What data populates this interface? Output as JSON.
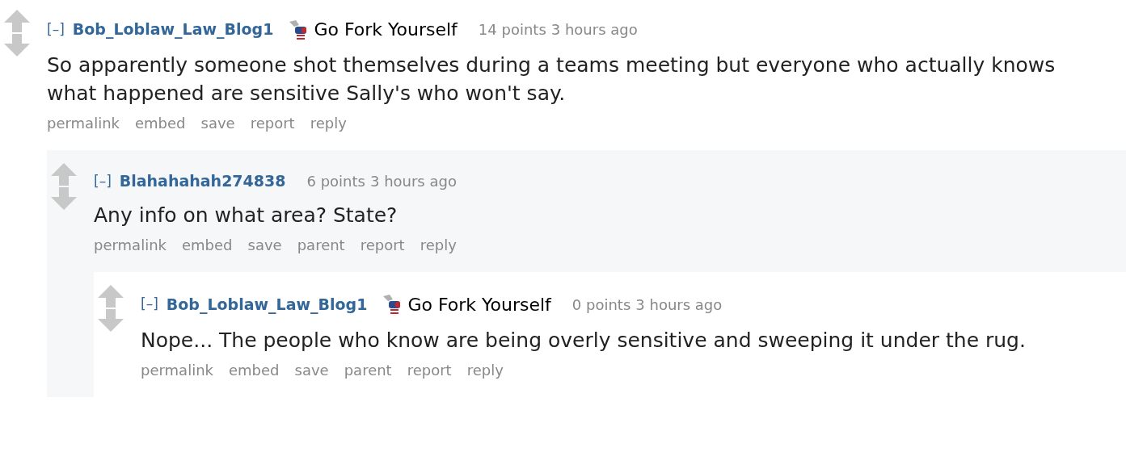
{
  "comments": [
    {
      "collapse": "[–]",
      "author": "Bob_Loblaw_Law_Blog1",
      "flair": "Go Fork Yourself",
      "score": "14 points",
      "time": "3 hours ago",
      "body": "So apparently someone shot themselves during a teams meeting but everyone who actually knows what happened are sensitive Sally's who won't say.",
      "actions": [
        "permalink",
        "embed",
        "save",
        "report",
        "reply"
      ],
      "children": [
        {
          "collapse": "[–]",
          "author": "Blahahahah274838",
          "score": "6 points",
          "time": "3 hours ago",
          "body": "Any info on what area? State?",
          "actions": [
            "permalink",
            "embed",
            "save",
            "parent",
            "report",
            "reply"
          ],
          "children": [
            {
              "collapse": "[–]",
              "author": "Bob_Loblaw_Law_Blog1",
              "flair": "Go Fork Yourself",
              "score": "0 points",
              "time": "3 hours ago",
              "body": "Nope... The people who know are being overly sensitive and sweeping it under the rug.",
              "actions": [
                "permalink",
                "embed",
                "save",
                "parent",
                "report",
                "reply"
              ]
            }
          ]
        }
      ]
    }
  ]
}
